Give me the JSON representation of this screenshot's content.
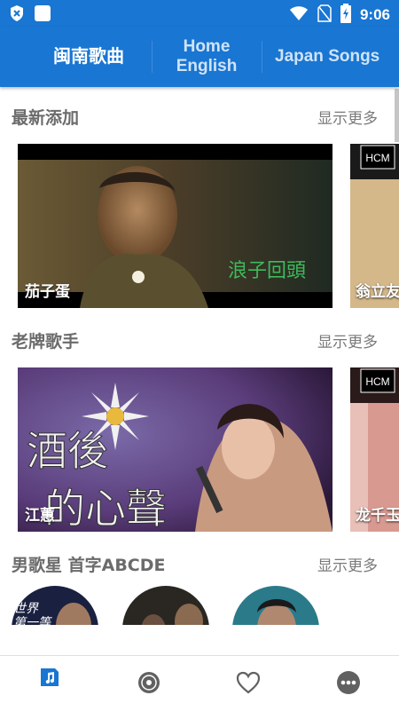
{
  "status_bar": {
    "time": "9:06",
    "icons": [
      "shield-x-icon",
      "app-square-icon",
      "wifi-icon",
      "no-sim-icon",
      "battery-charging-icon"
    ]
  },
  "tabs": [
    {
      "label": "闽南歌曲",
      "active": true
    },
    {
      "label": "Home\nEnglish",
      "active": false
    },
    {
      "label": "Japan Songs",
      "active": false
    }
  ],
  "sections": [
    {
      "title": "最新添加",
      "more": "显示更多",
      "cards": [
        {
          "label": "茄子蛋",
          "overlay_text": "浪子回頭"
        },
        {
          "label": "翁立友",
          "badge": "HCM"
        }
      ]
    },
    {
      "title": "老牌歌手",
      "more": "显示更多",
      "cards": [
        {
          "label": "江蕙",
          "overlay_text": "酒後的心聲"
        },
        {
          "label": "龙千玉",
          "badge": "HCM"
        }
      ]
    },
    {
      "title": "男歌星 首字ABCDE",
      "more": "显示更多",
      "circles": [
        {
          "overlay_text": "世界第一等"
        },
        {
          "overlay_text": ""
        },
        {
          "overlay_text": ""
        }
      ]
    }
  ],
  "bottom_nav": [
    "music-note-icon",
    "vinyl-disc-icon",
    "heart-icon",
    "more-dots-icon"
  ],
  "colors": {
    "primary": "#1976d2",
    "active_nav": "#1976d2",
    "inactive_nav": "#616161"
  }
}
